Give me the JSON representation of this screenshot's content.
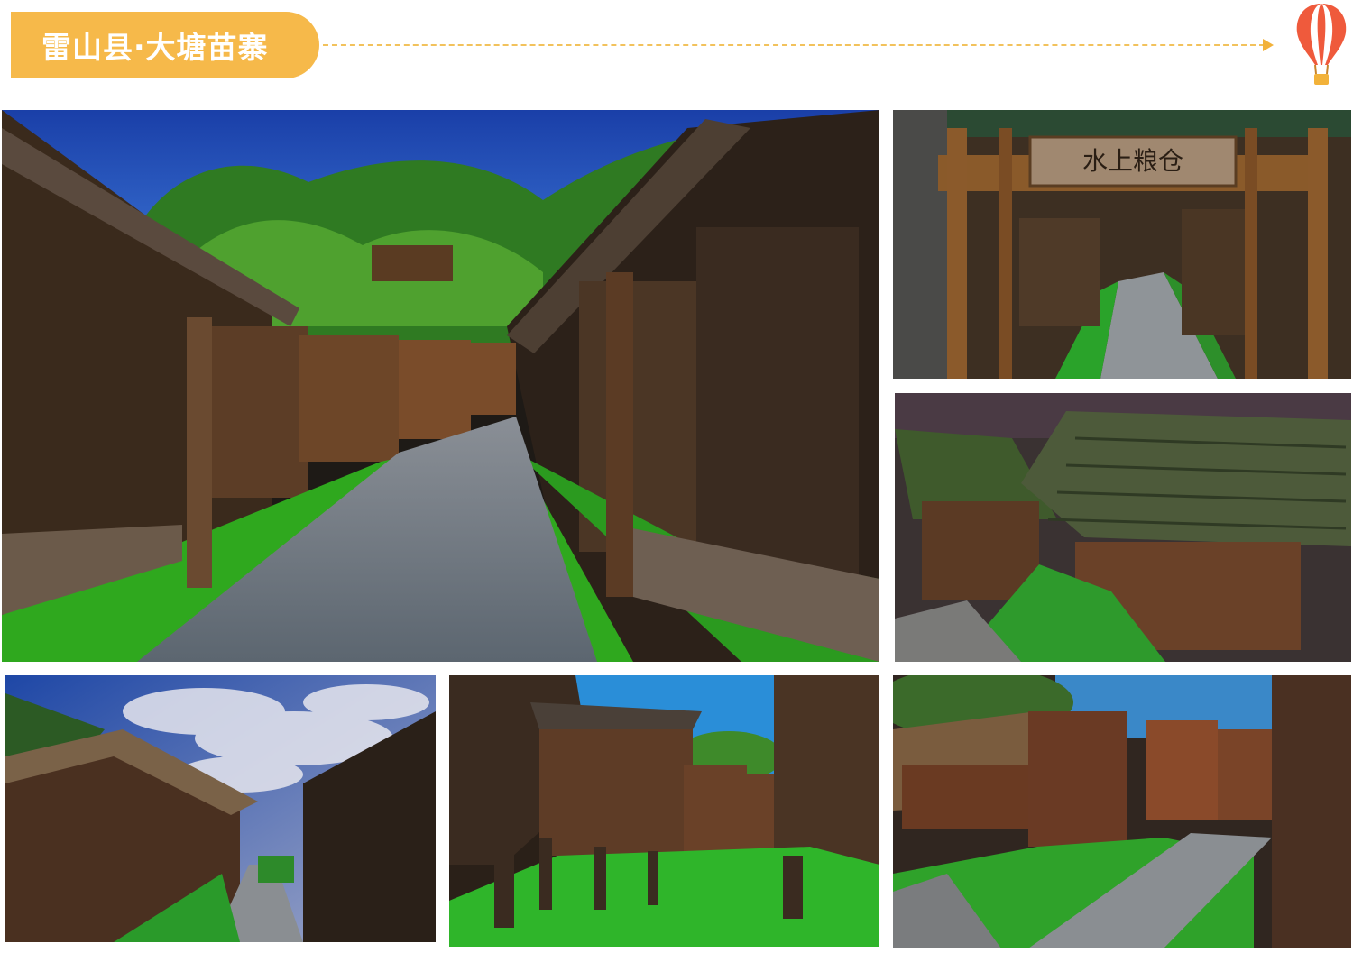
{
  "header": {
    "title": "雷山县·大塘苗寨",
    "colors": {
      "pill": "#f6b94a",
      "dash": "#f2c25c",
      "balloon": "#ef5a3c"
    },
    "icon": "hot-air-balloon-icon"
  },
  "photos": [
    {
      "id": "main-stone-path",
      "sign": ""
    },
    {
      "id": "gateway-sign",
      "sign": "水上粮仓"
    },
    {
      "id": "tiled-roofs",
      "sign": ""
    },
    {
      "id": "cloudy-sky-path",
      "sign": ""
    },
    {
      "id": "granaries-green-water-1",
      "sign": ""
    },
    {
      "id": "granaries-green-water-2",
      "sign": ""
    }
  ]
}
